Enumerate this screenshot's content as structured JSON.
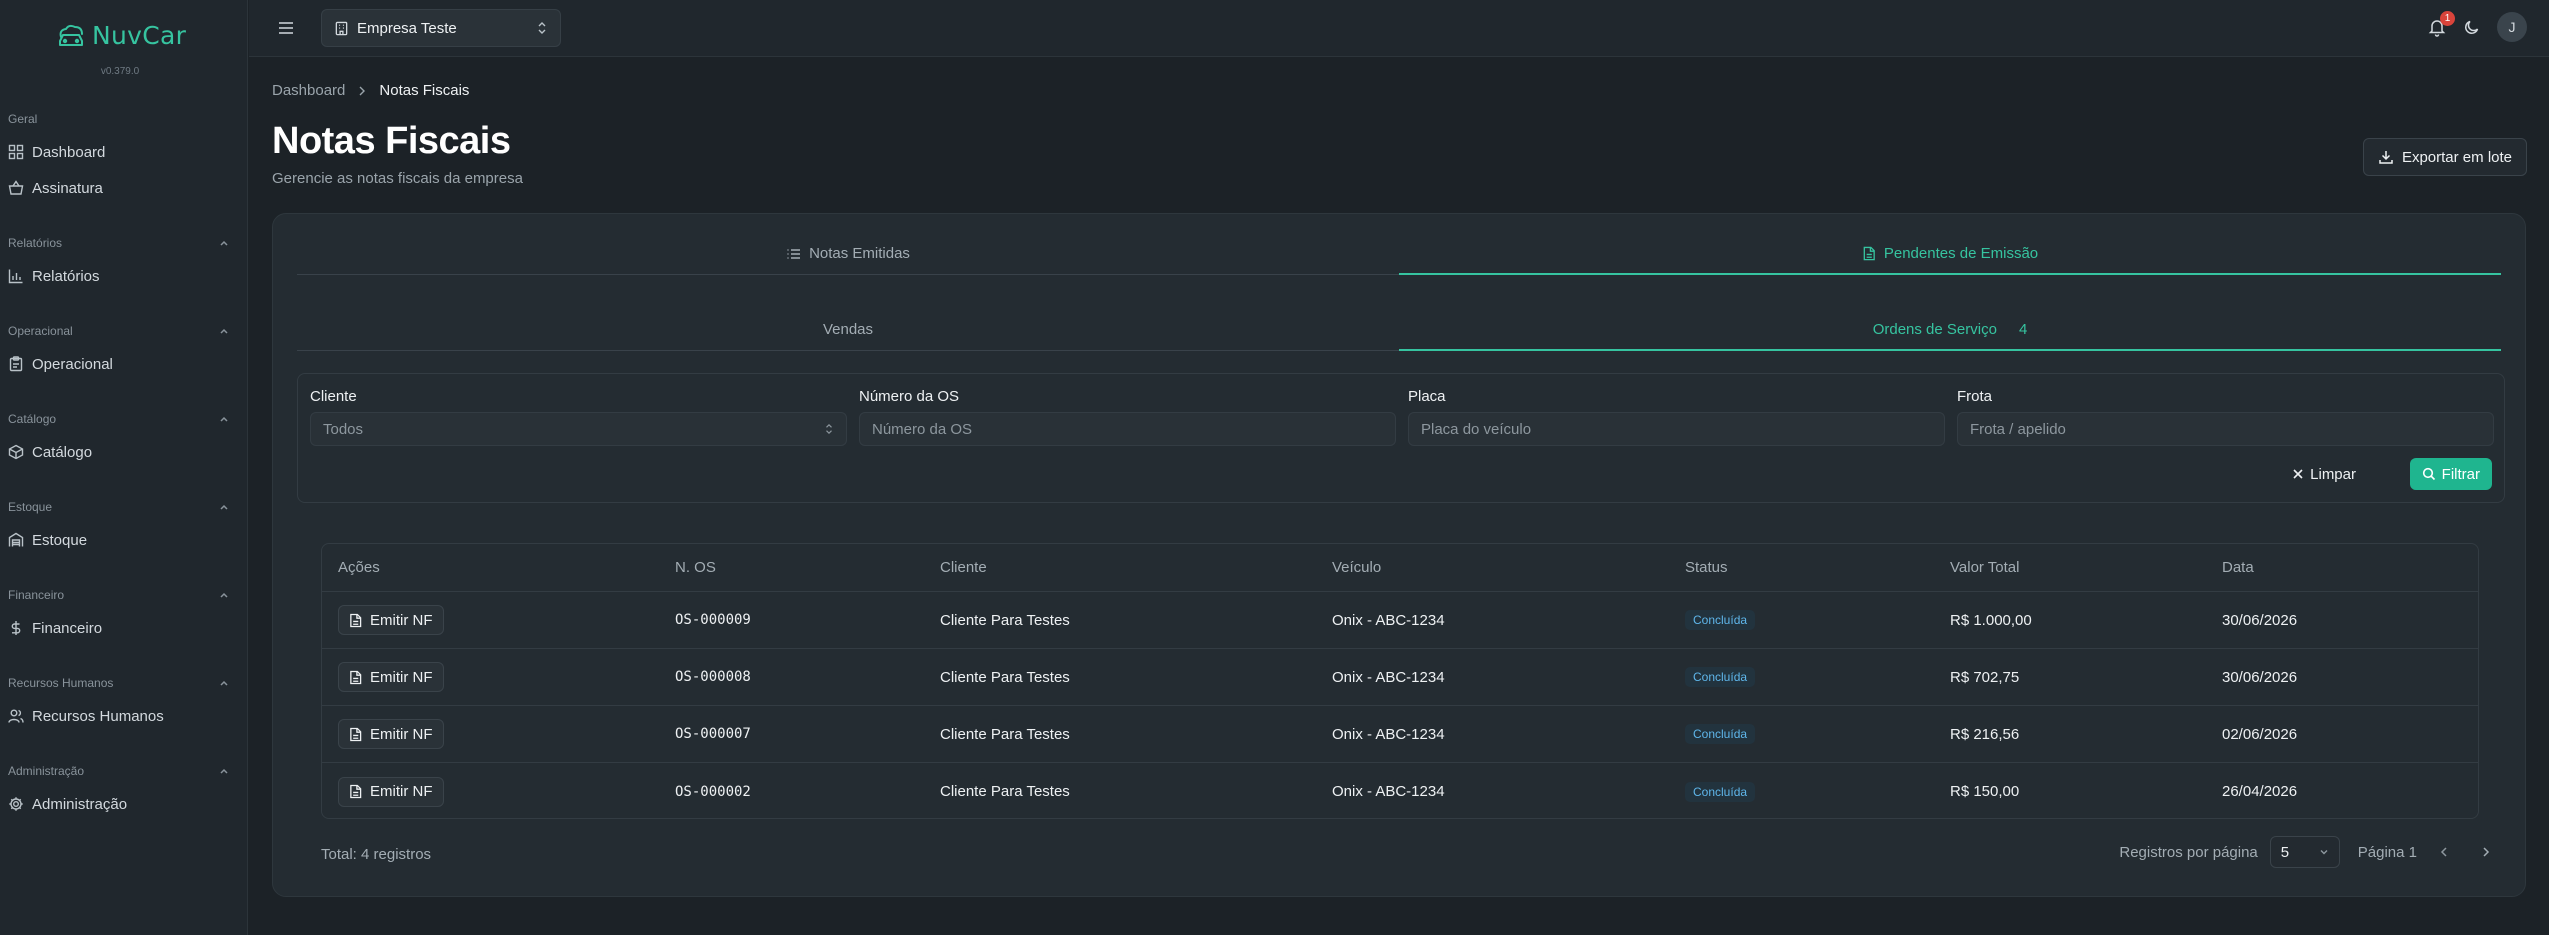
{
  "brand": {
    "name": "NuvCar",
    "version": "v0.379.0"
  },
  "sidebar": {
    "groups": [
      {
        "title": "Geral",
        "collapsible": false,
        "items": [
          {
            "label": "Dashboard",
            "icon": "grid-icon"
          },
          {
            "label": "Assinatura",
            "icon": "basket-icon"
          }
        ]
      },
      {
        "title": "Relatórios",
        "collapsible": true,
        "items": [
          {
            "label": "Relatórios",
            "icon": "bar-chart-icon"
          }
        ]
      },
      {
        "title": "Operacional",
        "collapsible": true,
        "items": [
          {
            "label": "Operacional",
            "icon": "clipboard-icon"
          }
        ]
      },
      {
        "title": "Catálogo",
        "collapsible": true,
        "items": [
          {
            "label": "Catálogo",
            "icon": "package-icon"
          }
        ]
      },
      {
        "title": "Estoque",
        "collapsible": true,
        "items": [
          {
            "label": "Estoque",
            "icon": "warehouse-icon"
          }
        ]
      },
      {
        "title": "Financeiro",
        "collapsible": true,
        "items": [
          {
            "label": "Financeiro",
            "icon": "dollar-icon"
          }
        ]
      },
      {
        "title": "Recursos Humanos",
        "collapsible": true,
        "items": [
          {
            "label": "Recursos Humanos",
            "icon": "users-icon"
          }
        ]
      },
      {
        "title": "Administração",
        "collapsible": true,
        "items": [
          {
            "label": "Administração",
            "icon": "gear-icon"
          }
        ]
      }
    ]
  },
  "topbar": {
    "company": "Empresa Teste",
    "notifications_count": "1",
    "avatar_initial": "J"
  },
  "breadcrumb": {
    "parent": "Dashboard",
    "current": "Notas Fiscais"
  },
  "page": {
    "title": "Notas Fiscais",
    "subtitle": "Gerencie as notas fiscais da empresa",
    "export_label": "Exportar em lote"
  },
  "tabs": {
    "primary": [
      {
        "label": "Notas Emitidas",
        "active": false
      },
      {
        "label": "Pendentes de Emissão",
        "active": true
      }
    ],
    "secondary": [
      {
        "label": "Vendas",
        "active": false
      },
      {
        "label": "Ordens de Serviço",
        "count": "4",
        "active": true
      }
    ]
  },
  "filters": {
    "cliente": {
      "label": "Cliente",
      "value": "Todos"
    },
    "numero_os": {
      "label": "Número da OS",
      "placeholder": "Número da OS"
    },
    "placa": {
      "label": "Placa",
      "placeholder": "Placa do veículo"
    },
    "frota": {
      "label": "Frota",
      "placeholder": "Frota / apelido"
    },
    "clear_label": "Limpar",
    "filter_label": "Filtrar"
  },
  "table": {
    "columns": [
      "Ações",
      "N. OS",
      "Cliente",
      "Veículo",
      "Status",
      "Valor Total",
      "Data"
    ],
    "action_label": "Emitir NF",
    "rows": [
      {
        "os": "OS-000009",
        "cliente": "Cliente Para Testes",
        "veiculo": "Onix - ABC-1234",
        "status": "Concluída",
        "valor": "R$ 1.000,00",
        "data": "30/06/2026"
      },
      {
        "os": "OS-000008",
        "cliente": "Cliente Para Testes",
        "veiculo": "Onix - ABC-1234",
        "status": "Concluída",
        "valor": "R$ 702,75",
        "data": "30/06/2026"
      },
      {
        "os": "OS-000007",
        "cliente": "Cliente Para Testes",
        "veiculo": "Onix - ABC-1234",
        "status": "Concluída",
        "valor": "R$ 216,56",
        "data": "02/06/2026"
      },
      {
        "os": "OS-000002",
        "cliente": "Cliente Para Testes",
        "veiculo": "Onix - ABC-1234",
        "status": "Concluída",
        "valor": "R$ 150,00",
        "data": "26/04/2026"
      }
    ]
  },
  "pagination": {
    "total": "Total: 4 registros",
    "per_page_label": "Registros por página",
    "per_page": "5",
    "page_label": "Página 1"
  },
  "colors": {
    "accent": "#36c4a0",
    "button": "#1fb58f",
    "status": "#5fb6ea",
    "badge": "#d9443b"
  }
}
